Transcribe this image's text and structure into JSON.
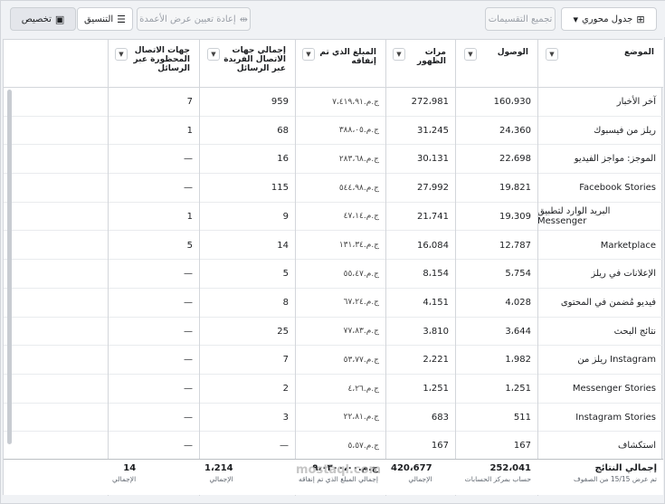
{
  "toolbar": {
    "customize_label": "تخصيص",
    "format_label": "التنسيق",
    "reset_label": "إعادة تعيين عرض الأعمدة",
    "breakdown_label": "تجميع التقسيمات",
    "pivot_label": "جدول محوري"
  },
  "headers": {
    "placement": "الموضع",
    "reach": "الوصول",
    "impressions": "مرات الظهور",
    "spent": "المبلغ الذي تم إنفاقه",
    "contacts": "إجمالي جهات الاتصال الفريدة عبر الرسائل",
    "blocked": "جهات الاتصال المحظورة عبر الرسائل"
  },
  "rows": [
    {
      "placement": "آخر الأخبار",
      "reach": "160،930",
      "impressions": "272،981",
      "spent": "ج.م.‏٧،٤١٩،٩١",
      "contacts": "959",
      "blocked": "7"
    },
    {
      "placement": "ريلز من فيسبوك",
      "reach": "24،360",
      "impressions": "31،245",
      "spent": "ج.م.‏٣٨٨،٠٥",
      "contacts": "68",
      "blocked": "1"
    },
    {
      "placement": "الموجز: مواجز الفيديو",
      "reach": "22،698",
      "impressions": "30،131",
      "spent": "ج.م.‏٢٨٣،٦٨",
      "contacts": "16",
      "blocked": "—"
    },
    {
      "placement": "Facebook Stories",
      "reach": "19،821",
      "impressions": "27،992",
      "spent": "ج.م.‏٥٤٤،٩٨",
      "contacts": "115",
      "blocked": "—"
    },
    {
      "placement": "البريد الوارد لتطبيق Messenger",
      "reach": "19،309",
      "impressions": "21،741",
      "spent": "ج.م.‏٤٧،١٤",
      "contacts": "9",
      "blocked": "1"
    },
    {
      "placement": "Marketplace",
      "reach": "12،787",
      "impressions": "16،084",
      "spent": "ج.م.‏١٣١،٣٤",
      "contacts": "14",
      "blocked": "5"
    },
    {
      "placement": "الإعلانات في ريلز",
      "reach": "5،754",
      "impressions": "8،154",
      "spent": "ج.م.‏٥٥،٤٧",
      "contacts": "5",
      "blocked": "—"
    },
    {
      "placement": "فيديو مُضمن في المحتوى",
      "reach": "4،028",
      "impressions": "4،151",
      "spent": "ج.م.‏٦٧،٢٤",
      "contacts": "8",
      "blocked": "—"
    },
    {
      "placement": "نتائج البحث",
      "reach": "3،644",
      "impressions": "3،810",
      "spent": "ج.م.‏٧٧،٨٣",
      "contacts": "25",
      "blocked": "—"
    },
    {
      "placement": "ريلز من Instagram",
      "reach": "1،982",
      "impressions": "2،221",
      "spent": "ج.م.‏٥٣،٧٧",
      "contacts": "7",
      "blocked": "—"
    },
    {
      "placement": "Messenger Stories",
      "reach": "1،251",
      "impressions": "1،251",
      "spent": "ج.م.‏٤،٢٦",
      "contacts": "2",
      "blocked": "—"
    },
    {
      "placement": "Instagram Stories",
      "reach": "511",
      "impressions": "683",
      "spent": "ج.م.‏٢٢،٨١",
      "contacts": "3",
      "blocked": "—"
    },
    {
      "placement": "استكشاف",
      "reach": "167",
      "impressions": "167",
      "spent": "ج.م.‏٥،٥٧",
      "contacts": "—",
      "blocked": "—"
    }
  ],
  "footer": {
    "label": "إجمالي النتائج",
    "label_sub": "تم عرض 15/15 من الصفوف",
    "reach": "252،041",
    "reach_sub": "حساب بمركز الحسابات",
    "impressions": "420،677",
    "impressions_sub": "الإجمالي",
    "spent": "ج.م.‏٩،٠٣٠٠،٠٠",
    "spent_sub": "إجمالي المبلغ الذي تم إنفاقه",
    "contacts": "1،214",
    "contacts_sub": "الإجمالي",
    "blocked": "14",
    "blocked_sub": "الإجمالي"
  },
  "watermark": "mostaql.com"
}
